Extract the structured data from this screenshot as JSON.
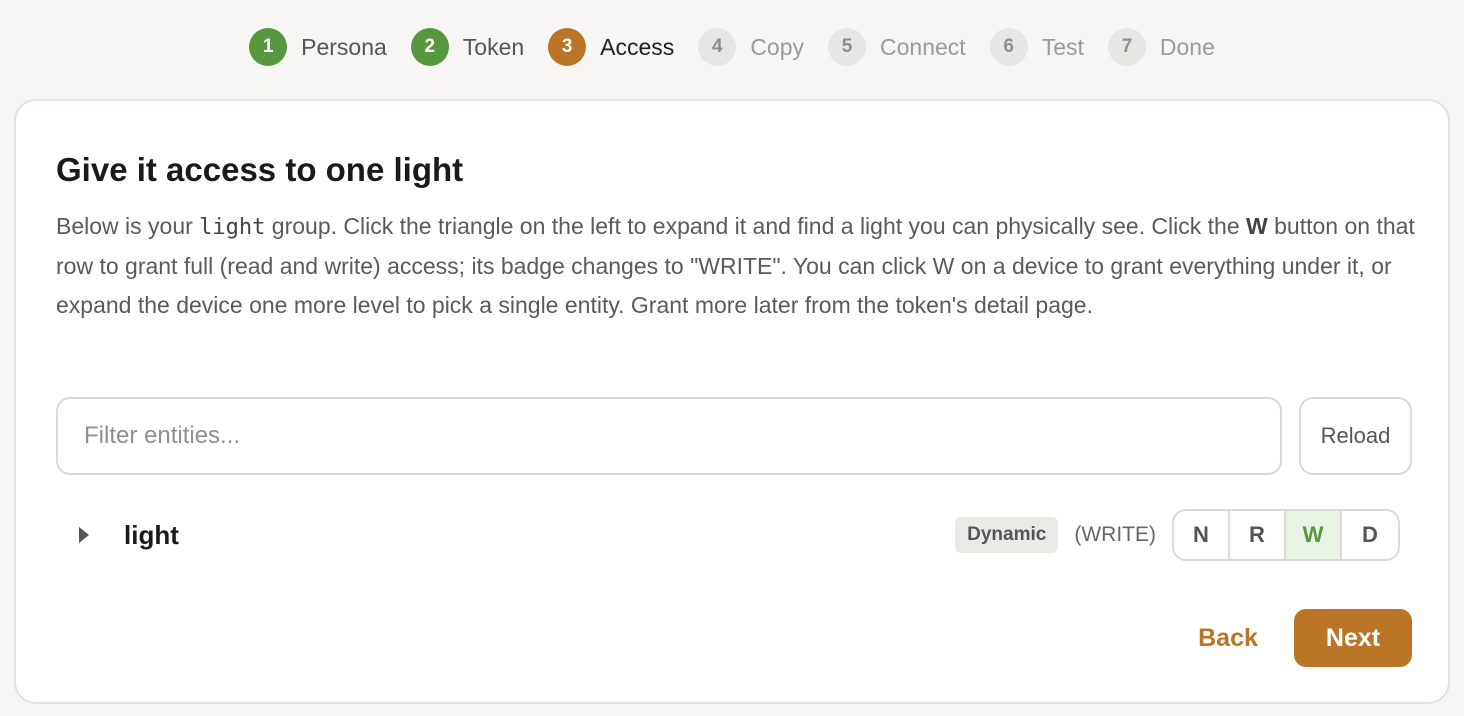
{
  "stepper": {
    "steps": [
      {
        "num": "1",
        "label": "Persona",
        "state": "done"
      },
      {
        "num": "2",
        "label": "Token",
        "state": "done"
      },
      {
        "num": "3",
        "label": "Access",
        "state": "current"
      },
      {
        "num": "4",
        "label": "Copy",
        "state": "todo"
      },
      {
        "num": "5",
        "label": "Connect",
        "state": "todo"
      },
      {
        "num": "6",
        "label": "Test",
        "state": "todo"
      },
      {
        "num": "7",
        "label": "Done",
        "state": "todo"
      }
    ]
  },
  "card": {
    "title": "Give it access to one light",
    "desc": {
      "p1": "Below is your ",
      "code": "light",
      "p2": " group. Click the triangle on the left to expand it and find a light you can physically see. Click the ",
      "bold": "W",
      "p3": " button on that row to grant full (read and write) access; its badge changes to \"WRITE\". You can click W on a device to grant everything under it, or expand the device one more level to pick a single entity. Grant more later from the token's detail page."
    }
  },
  "filter": {
    "placeholder": "Filter entities...",
    "value": ""
  },
  "reload_label": "Reload",
  "entity": {
    "name": "light",
    "badge": "Dynamic",
    "access_level": "(WRITE)",
    "expand_icon": "caret-right-icon",
    "buttons": [
      {
        "label": "N",
        "active": false
      },
      {
        "label": "R",
        "active": false
      },
      {
        "label": "W",
        "active": true
      },
      {
        "label": "D",
        "active": false
      }
    ]
  },
  "footer": {
    "back_label": "Back",
    "next_label": "Next"
  },
  "colors": {
    "done": "#57983f",
    "current": "#ba7626",
    "todo": "#e8e6e3",
    "accent": "#ba7626"
  }
}
